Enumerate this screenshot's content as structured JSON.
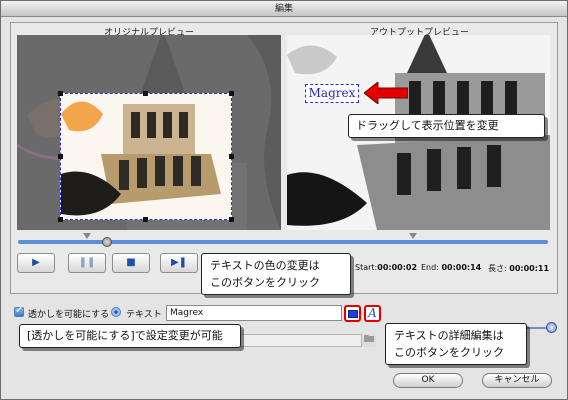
{
  "window": {
    "title": "編集"
  },
  "preview": {
    "original_label": "オリジナルプレビュー",
    "output_label": "アウトプットプレビュー"
  },
  "watermark_preview_text": "Magrex",
  "callouts": {
    "drag": "ドラッグして表示位置を変更",
    "color_line1": "テキストの色の変更は",
    "color_line2": "このボタンをクリック",
    "enable": "[透かしを可能にする]で設定変更が可能",
    "detail_line1": "テキストの詳細編集は",
    "detail_line2": "このボタンをクリック"
  },
  "controls": {
    "play_icon": "▶",
    "pause_icon": "❚❚",
    "stop_icon": "■",
    "next_icon": "▶❚"
  },
  "timecodes": {
    "start_label": "Start:",
    "start_value": "00:00:02",
    "end_label": "End:",
    "end_value": "00:00:14",
    "length_label": "長さ:",
    "length_value": "00:00:11"
  },
  "watermark": {
    "enable_label": "透かしを可能にする",
    "text_radio_label": "テキスト",
    "text_value": "Magrex",
    "edit_icon": "A"
  },
  "icons": {
    "play": "play-icon",
    "pause": "pause-icon",
    "stop": "stop-icon",
    "next": "next-frame-icon",
    "color": "color-swatch-icon",
    "edit": "text-edit-icon",
    "arrow": "red-arrow-icon",
    "folder": "folder-icon"
  },
  "buttons": {
    "ok": "OK",
    "cancel": "キャンセル"
  },
  "colors": {
    "watermark_text": "#2626c8",
    "highlight": "#e00000",
    "accent_blue": "#1e4fa8"
  }
}
